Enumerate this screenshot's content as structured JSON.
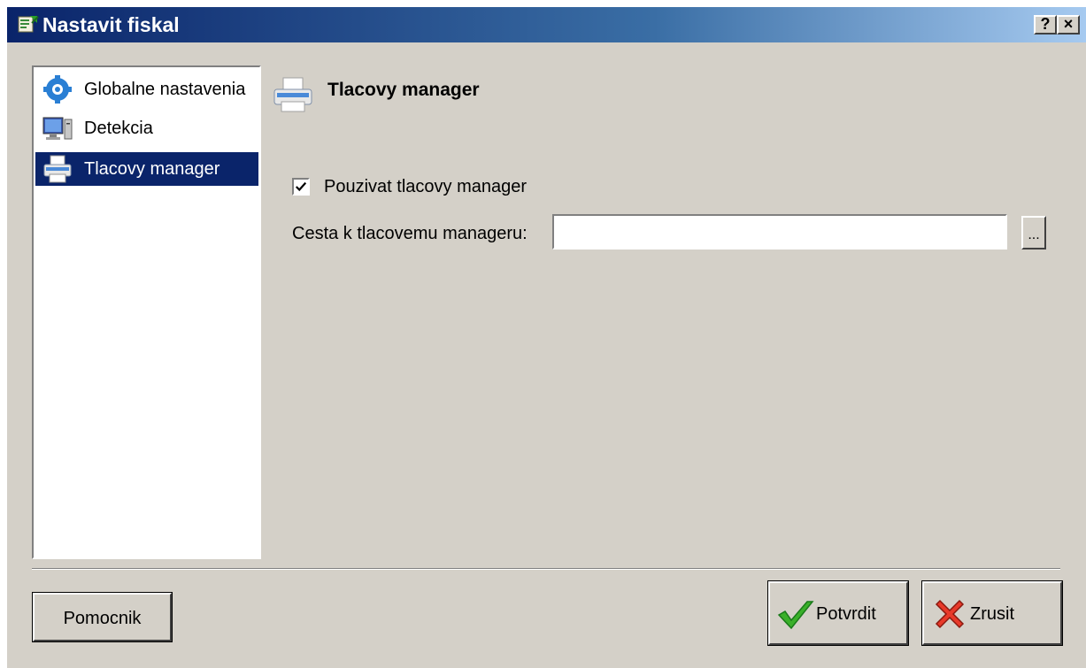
{
  "window": {
    "title": "Nastavit fiskal",
    "help_button": "?",
    "close_button": "×"
  },
  "nav": {
    "items": [
      {
        "label": "Globalne nastavenia",
        "icon": "gear-icon"
      },
      {
        "label": "Detekcia",
        "icon": "computer-icon"
      },
      {
        "label": "Tlacovy manager",
        "icon": "printer-icon",
        "selected": true
      }
    ]
  },
  "section": {
    "title": "Tlacovy manager",
    "icon": "printer-icon"
  },
  "form": {
    "use_manager_label": "Pouzivat tlacovy manager",
    "use_manager_checked": true,
    "checkmark": "✔",
    "path_label": "Cesta k tlacovemu manageru:",
    "path_value": "",
    "browse_label": "..."
  },
  "buttons": {
    "help": "Pomocnik",
    "ok": "Potvrdit",
    "cancel": "Zrusit"
  },
  "colors": {
    "titlebar_start": "#0a246a",
    "titlebar_end": "#a6caf0",
    "face": "#d4d0c8",
    "selection": "#0a246a"
  }
}
